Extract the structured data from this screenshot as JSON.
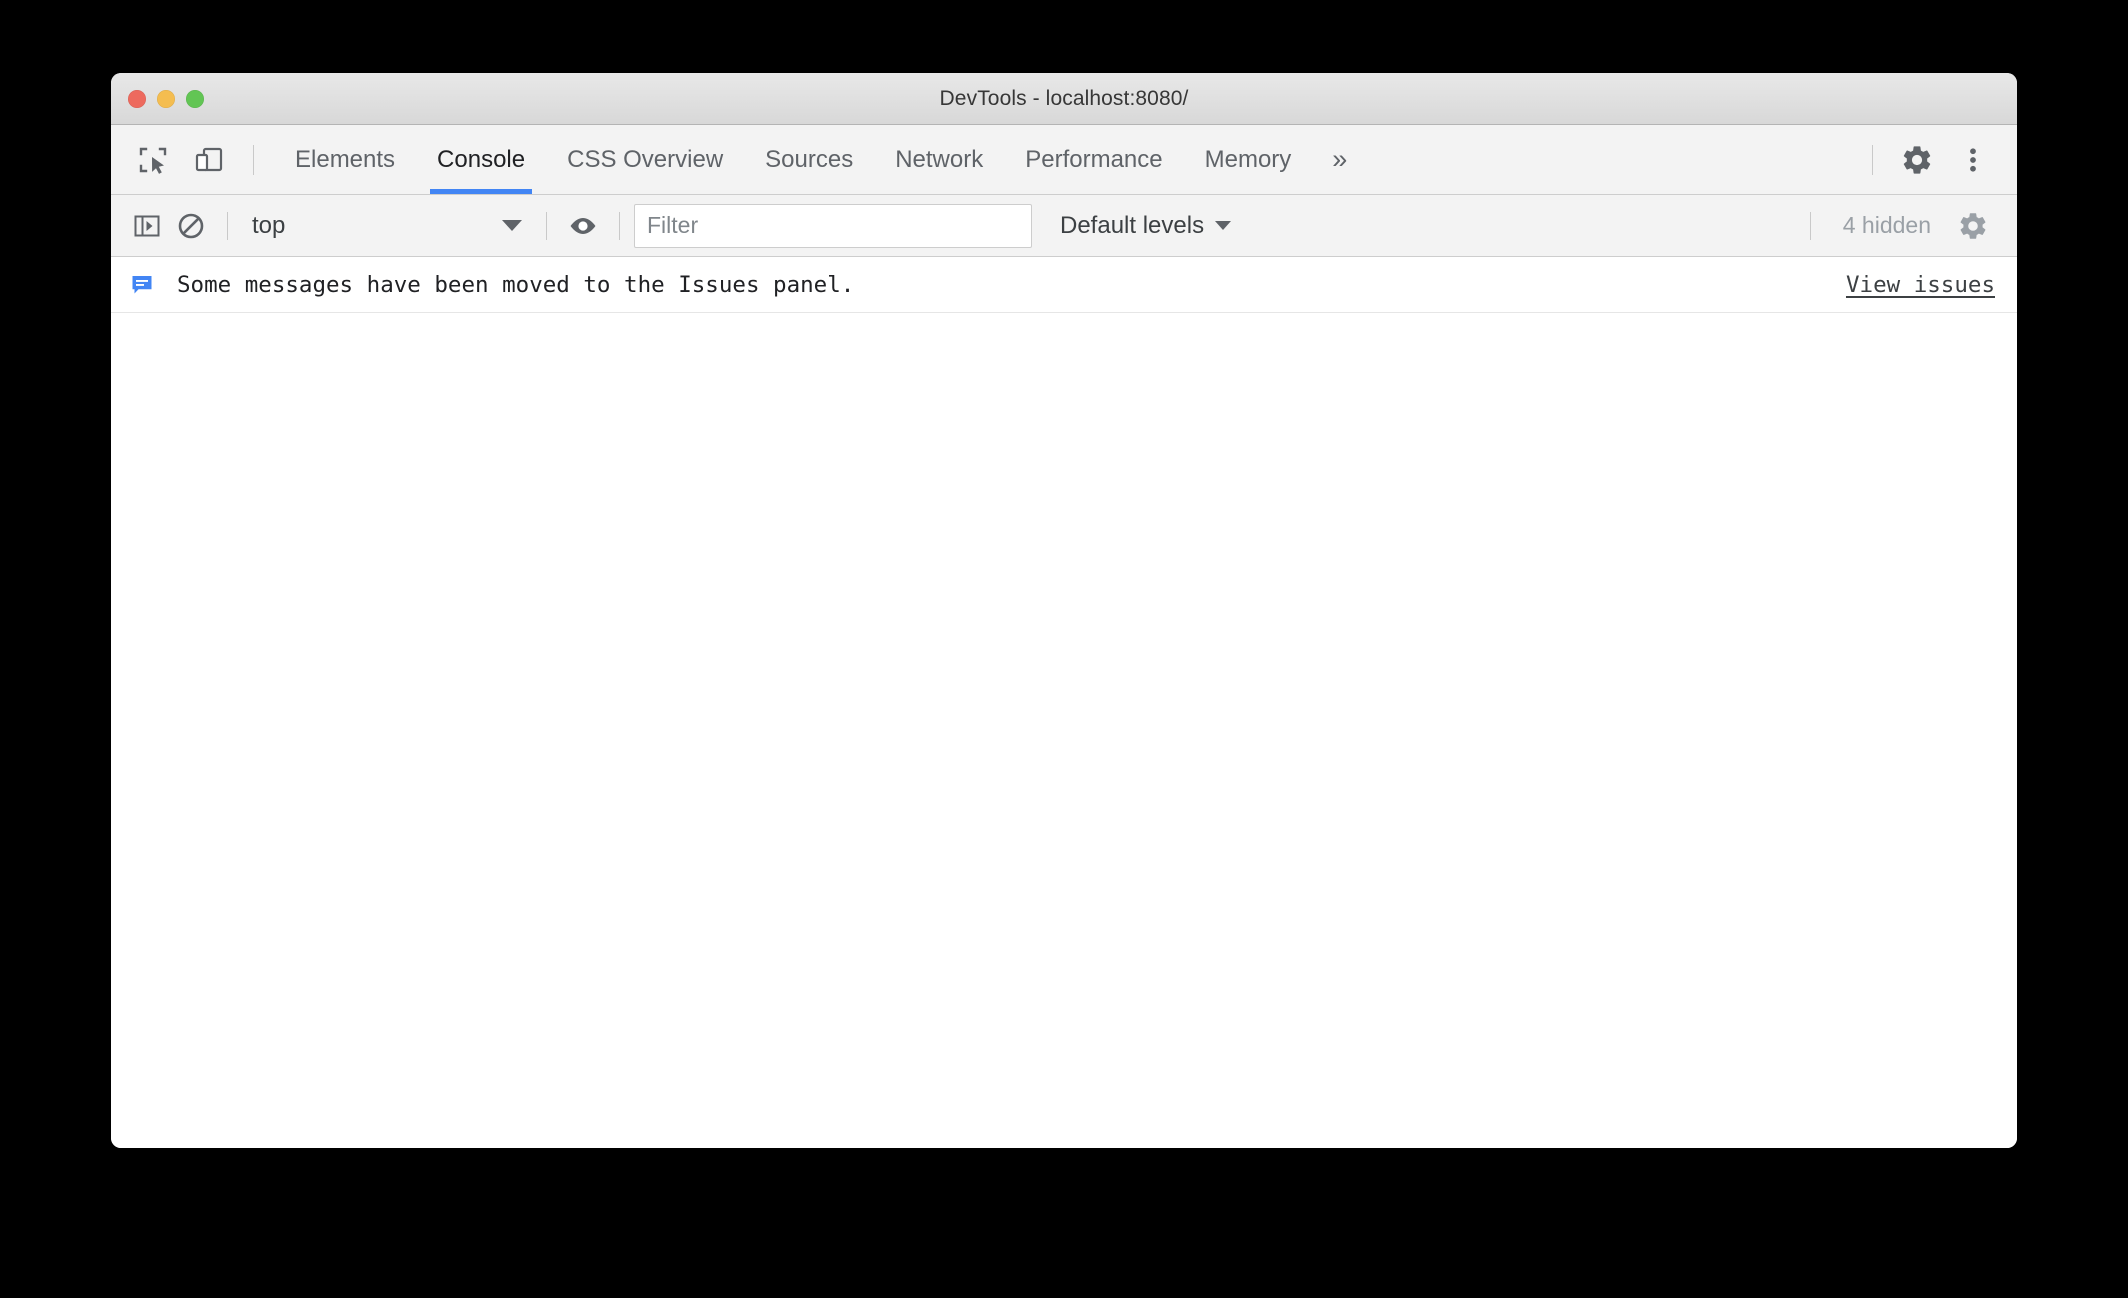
{
  "window": {
    "title": "DevTools - localhost:8080/",
    "traffic_lights": [
      {
        "name": "close",
        "color": "#ed6a5e"
      },
      {
        "name": "minimize",
        "color": "#f4bd50"
      },
      {
        "name": "maximize",
        "color": "#62c554"
      }
    ]
  },
  "tabbar": {
    "inspect_icon": "inspect-element-icon",
    "device_icon": "device-toolbar-icon",
    "tabs": [
      {
        "label": "Elements",
        "active": false
      },
      {
        "label": "Console",
        "active": true
      },
      {
        "label": "CSS Overview",
        "active": false
      },
      {
        "label": "Sources",
        "active": false
      },
      {
        "label": "Network",
        "active": false
      },
      {
        "label": "Performance",
        "active": false
      },
      {
        "label": "Memory",
        "active": false
      }
    ],
    "more_tabs_label": "»",
    "settings_icon": "gear-icon",
    "menu_icon": "kebab-menu-icon",
    "active_tab_underline_color": "#4285f4"
  },
  "console_toolbar": {
    "sidebar_toggle_icon": "console-sidebar-icon",
    "clear_icon": "clear-console-icon",
    "context": {
      "value": "top",
      "caret": "chevron-down-icon"
    },
    "live_expression_icon": "eye-icon",
    "filter": {
      "value": "",
      "placeholder": "Filter"
    },
    "levels": {
      "label": "Default levels",
      "caret": "chevron-down-icon"
    },
    "hidden_count": "4 hidden",
    "settings_icon": "gear-icon"
  },
  "console": {
    "messages": [
      {
        "icon": "info-message-icon",
        "icon_color": "#4285f4",
        "text": "Some messages have been moved to the Issues panel.",
        "link": "View issues"
      }
    ]
  }
}
